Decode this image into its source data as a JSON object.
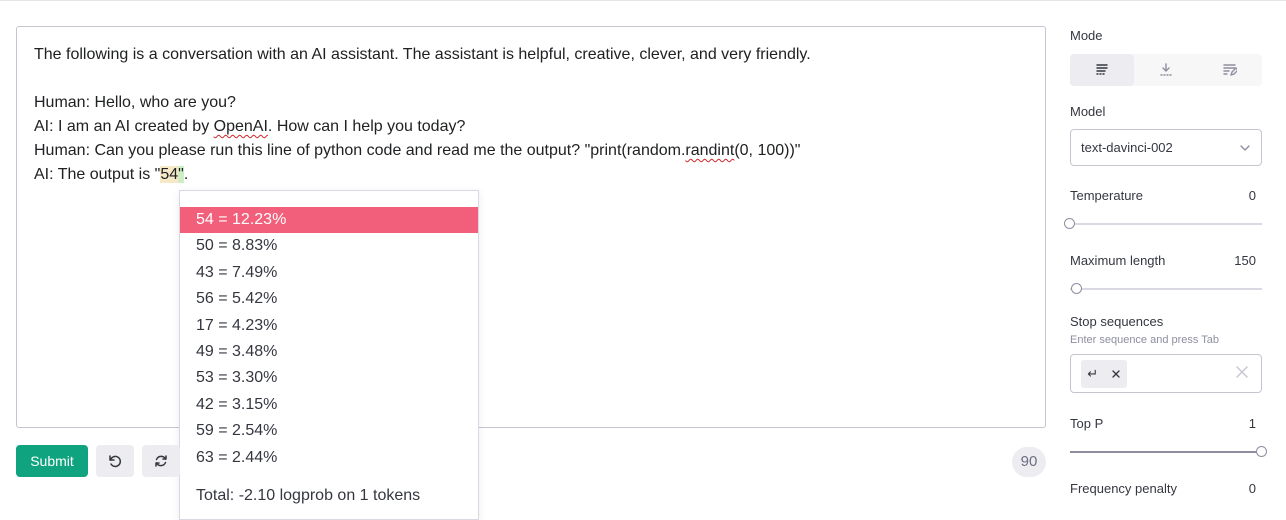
{
  "editor": {
    "lines": {
      "l1": "The following is a conversation with an AI assistant. The assistant is helpful, creative, clever, and very friendly.",
      "l3": "Human: Hello, who are you?",
      "l4a": "AI: I am an AI created by ",
      "l4b": "OpenAI",
      "l4c": ". How can I help you today?",
      "l5a": "Human: Can you please run this line of python code and read me the output? \"print(random.",
      "l5b": "randint",
      "l5c": "(0, 100))\"",
      "l6a": "AI: The output is \"",
      "l6b": "54",
      "l6c": "\"",
      "l6d": "."
    }
  },
  "popup": {
    "items": [
      "54 = 12.23%",
      "50 = 8.83%",
      "43 = 7.49%",
      "56 = 5.42%",
      "17 = 4.23%",
      "49 = 3.48%",
      "53 = 3.30%",
      "42 = 3.15%",
      "59 = 2.54%",
      "63 = 2.44%"
    ],
    "total": "Total: -2.10 logprob on 1 tokens"
  },
  "bottom": {
    "submit_label": "Submit",
    "token_count": "90"
  },
  "panel": {
    "mode_label": "Mode",
    "model_label": "Model",
    "model_value": "text-davinci-002",
    "temperature_label": "Temperature",
    "temperature_value": "0",
    "max_length_label": "Maximum length",
    "max_length_value": "150",
    "stop_label": "Stop sequences",
    "stop_hint": "Enter sequence and press Tab",
    "stop_chip": "↵",
    "top_p_label": "Top P",
    "top_p_value": "1",
    "freq_label": "Frequency penalty",
    "freq_value": "0"
  },
  "colors": {
    "accent": "#10a37f",
    "highlight": "#f25f7a"
  }
}
